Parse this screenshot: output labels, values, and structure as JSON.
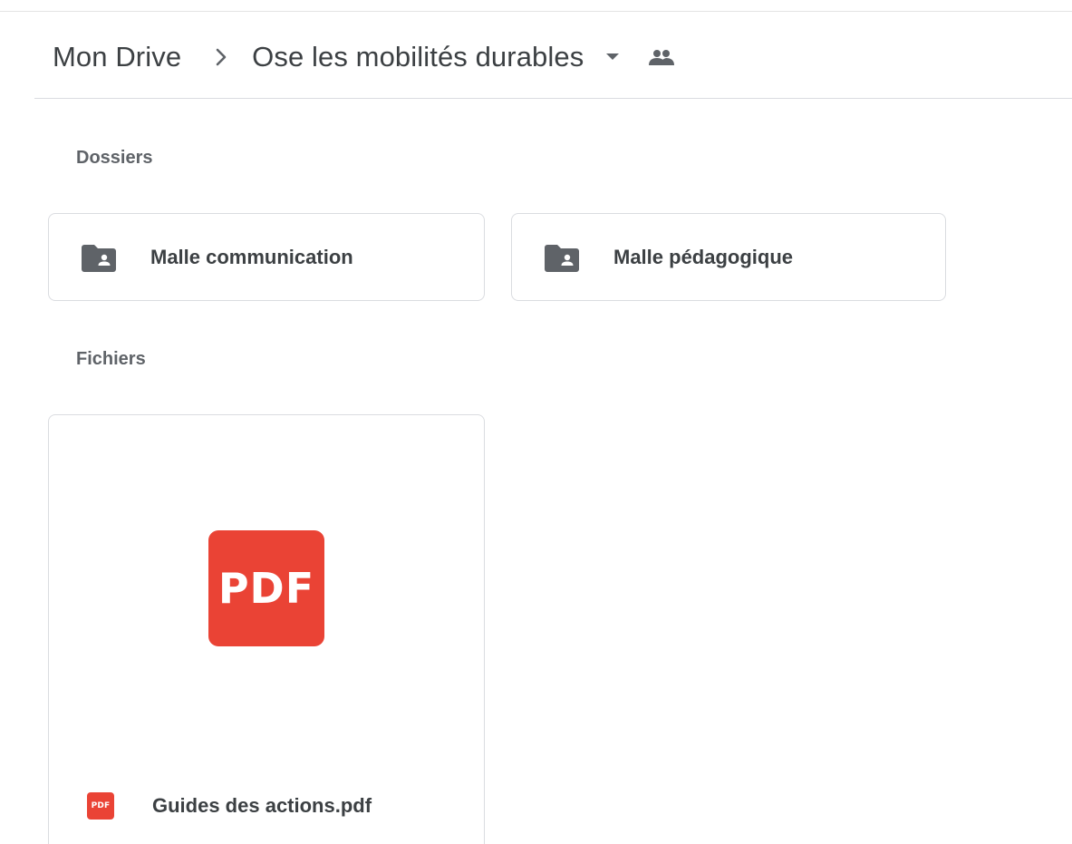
{
  "breadcrumb": {
    "root": "Mon Drive",
    "current": "Ose les mobilités durables",
    "separator_icon": "chevron-right-icon",
    "dropdown_icon": "caret-down-icon",
    "shared_icon": "shared-people-icon"
  },
  "sections": {
    "folders_label": "Dossiers",
    "files_label": "Fichiers"
  },
  "folders": [
    {
      "name": "Malle communication",
      "icon": "shared-folder-icon"
    },
    {
      "name": "Malle pédagogique",
      "icon": "shared-folder-icon"
    }
  ],
  "files": [
    {
      "name": "Guides des actions.pdf",
      "preview_label": "PDF",
      "type_badge": "PDF",
      "icon": "pdf-icon"
    }
  ],
  "colors": {
    "pdf_red": "#ea4335",
    "icon_gray": "#5f6368",
    "border": "#dadce0",
    "text": "#3c4043"
  }
}
